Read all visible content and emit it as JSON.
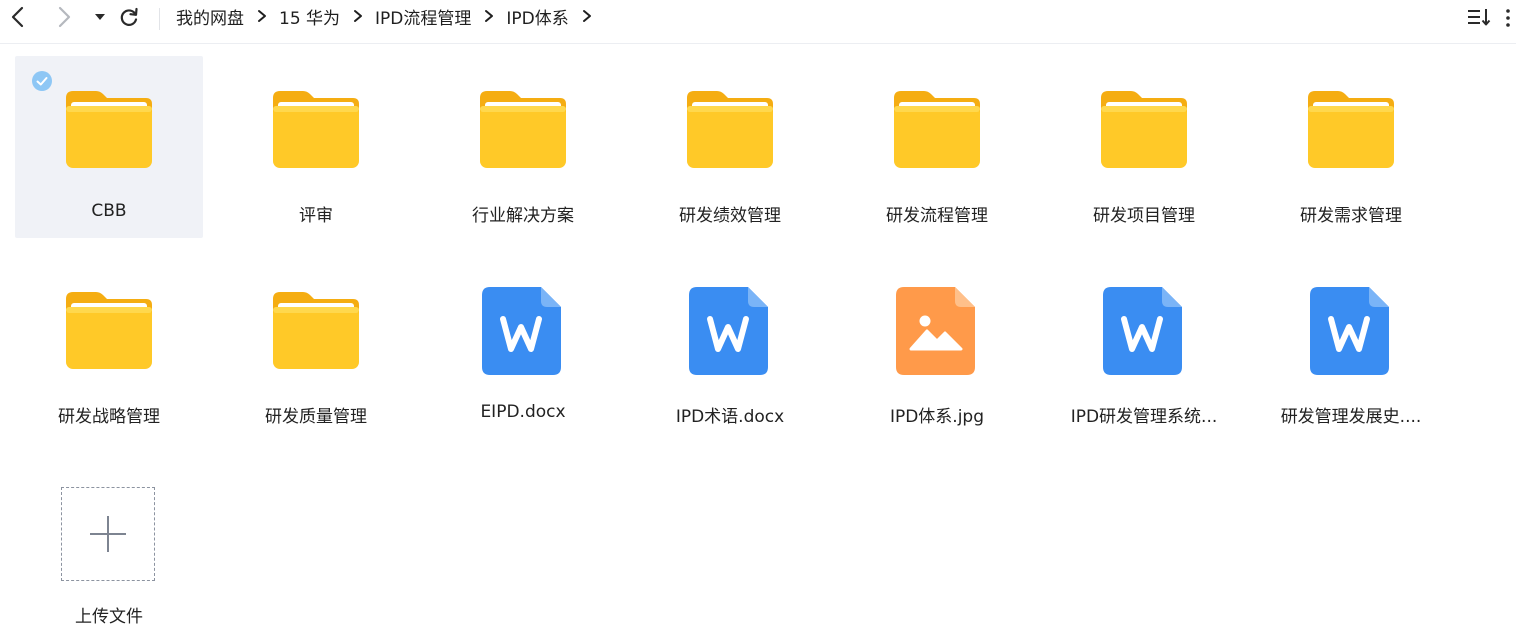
{
  "toolbar": {
    "back_icon": "chevron-left-icon",
    "forward_icon": "chevron-right-icon",
    "history_icon": "caret-down-icon",
    "refresh_icon": "refresh-icon",
    "sort_icon": "sort-icon",
    "more_icon": "more-vertical-icon"
  },
  "breadcrumb": [
    {
      "label": "我的网盘"
    },
    {
      "label": "15 华为"
    },
    {
      "label": "IPD流程管理"
    },
    {
      "label": "IPD体系"
    }
  ],
  "items": [
    {
      "name": "CBB",
      "type": "folder",
      "selected": true
    },
    {
      "name": "评审",
      "type": "folder"
    },
    {
      "name": "行业解决方案",
      "type": "folder"
    },
    {
      "name": "研发绩效管理",
      "type": "folder"
    },
    {
      "name": "研发流程管理",
      "type": "folder"
    },
    {
      "name": "研发项目管理",
      "type": "folder"
    },
    {
      "name": "研发需求管理",
      "type": "folder"
    },
    {
      "name": "研发战略管理",
      "type": "folder"
    },
    {
      "name": "研发质量管理",
      "type": "folder"
    },
    {
      "name": "EIPD.docx",
      "type": "word"
    },
    {
      "name": "IPD术语.docx",
      "type": "word"
    },
    {
      "name": "IPD体系.jpg",
      "type": "image"
    },
    {
      "name": "IPD研发管理系统...",
      "type": "word"
    },
    {
      "name": "研发管理发展史....",
      "type": "word"
    }
  ],
  "upload": {
    "label": "上传文件",
    "icon": "plus-icon"
  },
  "colors": {
    "folder_main": "#ffc928",
    "folder_back": "#f5ad12",
    "word_blue": "#3a8df2",
    "image_orange": "#ff9a4a",
    "check_blue": "#8ec7f5",
    "selected_bg": "#f0f2f7"
  }
}
